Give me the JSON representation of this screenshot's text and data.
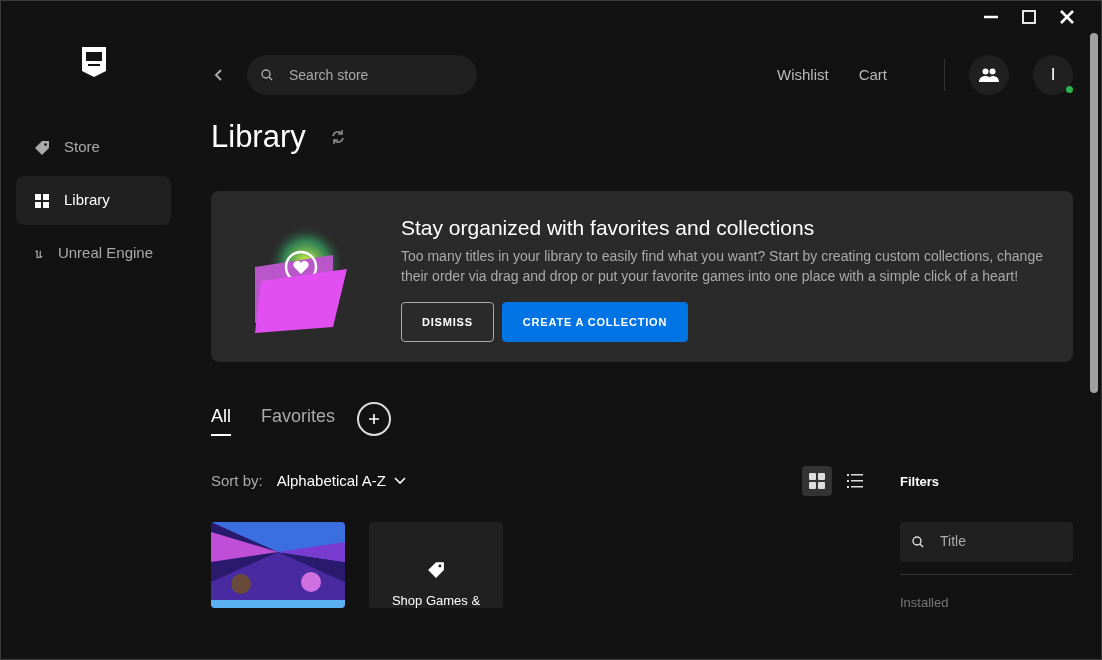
{
  "sidebar": {
    "items": [
      {
        "label": "Store",
        "selected": false
      },
      {
        "label": "Library",
        "selected": true
      },
      {
        "label": "Unreal Engine",
        "selected": false
      }
    ]
  },
  "topbar": {
    "search": {
      "placeholder": "Search store"
    },
    "links": [
      "Wishlist",
      "Cart"
    ],
    "avatar": {
      "initial": "I",
      "online": true
    }
  },
  "page": {
    "title": "Library"
  },
  "banner": {
    "title": "Stay organized with favorites and collections",
    "text": "Too many titles in your library to easily find what you want? Start by creating custom collections, change their order via drag and drop or put your favorite games into one place with a simple click of a heart!",
    "buttons": [
      {
        "label": "DISMISS",
        "kind": "outline"
      },
      {
        "label": "CREATE A COLLECTION",
        "kind": "primary"
      }
    ]
  },
  "tabs": [
    {
      "label": "All",
      "selected": true
    },
    {
      "label": "Favorites",
      "selected": false
    }
  ],
  "sort": {
    "label": "Sort by:",
    "value": "Alphabetical A-Z"
  },
  "views": [
    {
      "kind": "grid",
      "selected": true
    },
    {
      "kind": "list",
      "selected": false
    }
  ],
  "filters": {
    "title": "Filters",
    "search": {
      "placeholder": "Title"
    },
    "sections": [
      "Installed"
    ]
  },
  "tiles": [
    {
      "kind": "picture"
    },
    {
      "kind": "shop",
      "label": "Shop Games &"
    }
  ]
}
